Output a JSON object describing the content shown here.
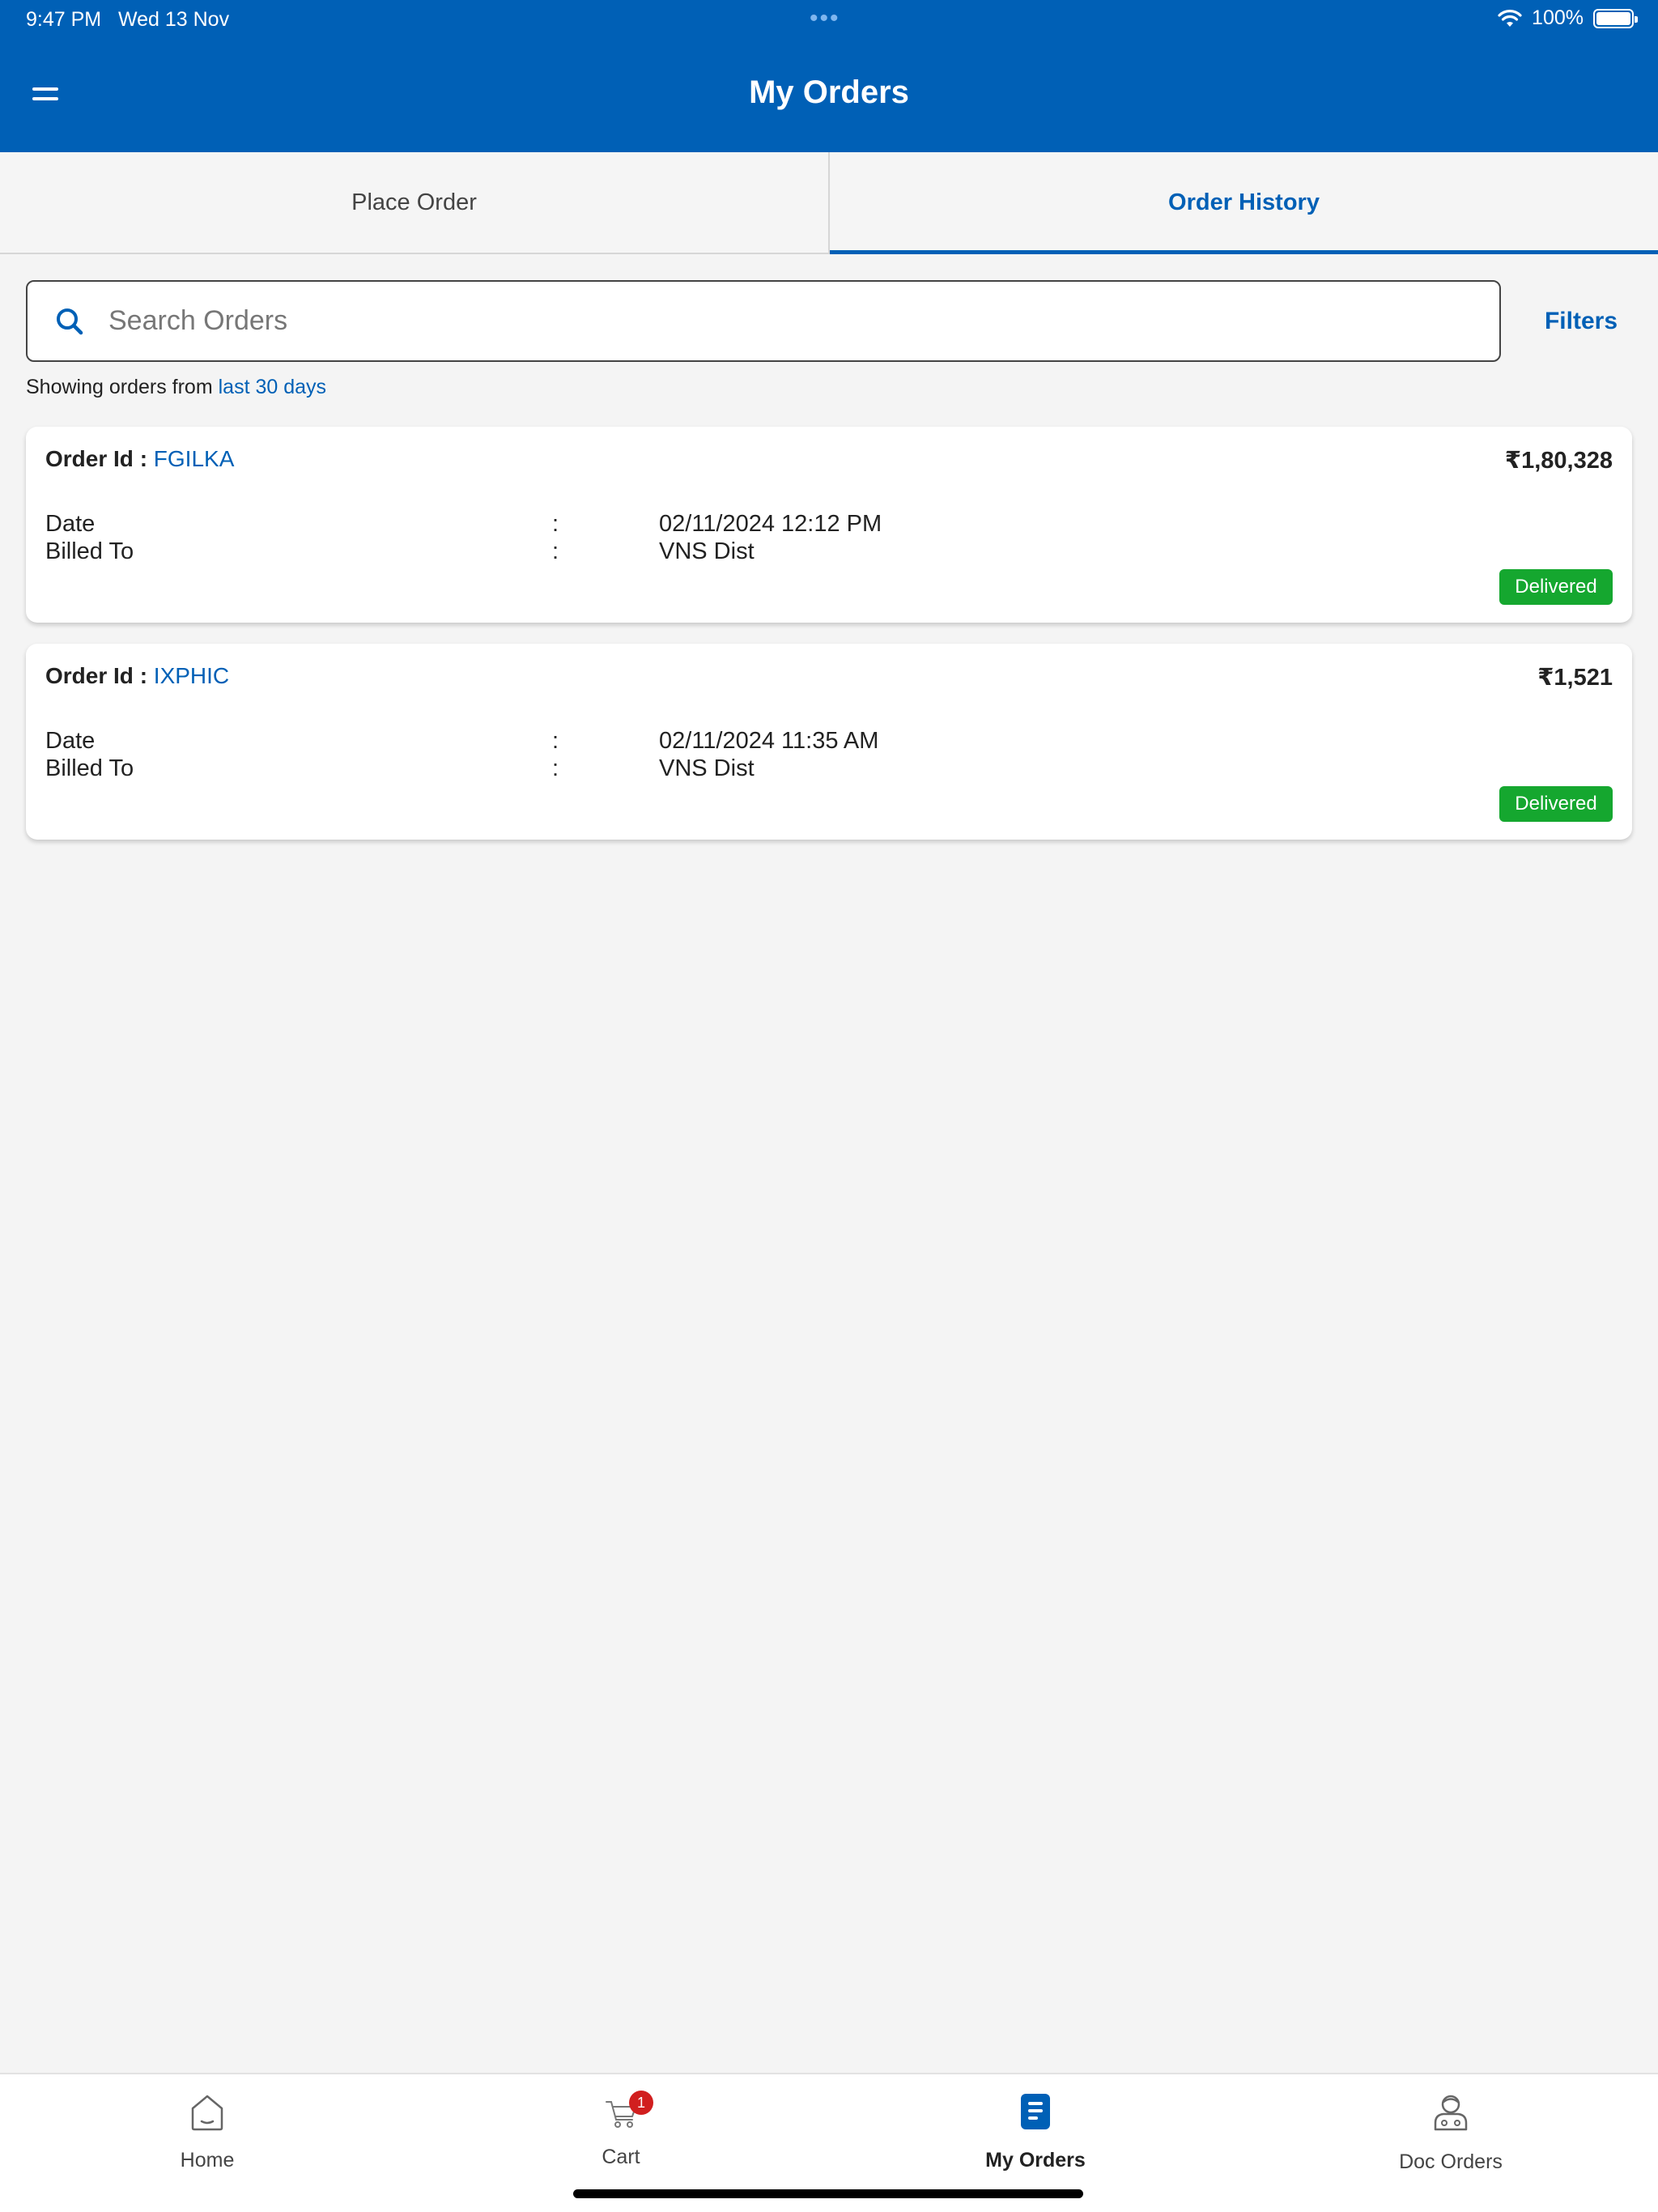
{
  "status_bar": {
    "time": "9:47 PM",
    "date": "Wed 13 Nov",
    "dots": "•••",
    "battery": "100%",
    "wifi_icon": "wifi-icon",
    "battery_icon": "battery-icon"
  },
  "header": {
    "title": "My Orders",
    "menu_icon": "menu-icon"
  },
  "tabs": [
    {
      "label": "Place Order",
      "active": false
    },
    {
      "label": "Order History",
      "active": true
    }
  ],
  "search": {
    "placeholder": "Search Orders",
    "value": "",
    "icon": "search-icon"
  },
  "filters_label": "Filters",
  "range": {
    "prefix": "Showing orders from",
    "link": "last 30 days"
  },
  "orders": [
    {
      "id_label": "Order Id :",
      "id": "FGILKA",
      "amount": "₹1,80,328",
      "date_label": "Date",
      "date": "02/11/2024 12:12 PM",
      "billed_label": "Billed To",
      "billed_to": "VNS Dist",
      "colon": ":",
      "status": "Delivered"
    },
    {
      "id_label": "Order Id :",
      "id": "IXPHIC",
      "amount": "₹1,521",
      "date_label": "Date",
      "date": "02/11/2024 11:35 AM",
      "billed_label": "Billed To",
      "billed_to": "VNS Dist",
      "colon": ":",
      "status": "Delivered"
    }
  ],
  "bottom_nav": [
    {
      "label": "Home",
      "icon": "home-icon"
    },
    {
      "label": "Cart",
      "icon": "cart-icon",
      "badge": "1"
    },
    {
      "label": "My Orders",
      "icon": "orders-icon",
      "active": true
    },
    {
      "label": "Doc Orders",
      "icon": "doctor-icon"
    }
  ],
  "colors": {
    "primary": "#0060b6",
    "status_delivered": "#15a72f",
    "badge_red": "#d11f1f",
    "background": "#f4f4f4"
  }
}
